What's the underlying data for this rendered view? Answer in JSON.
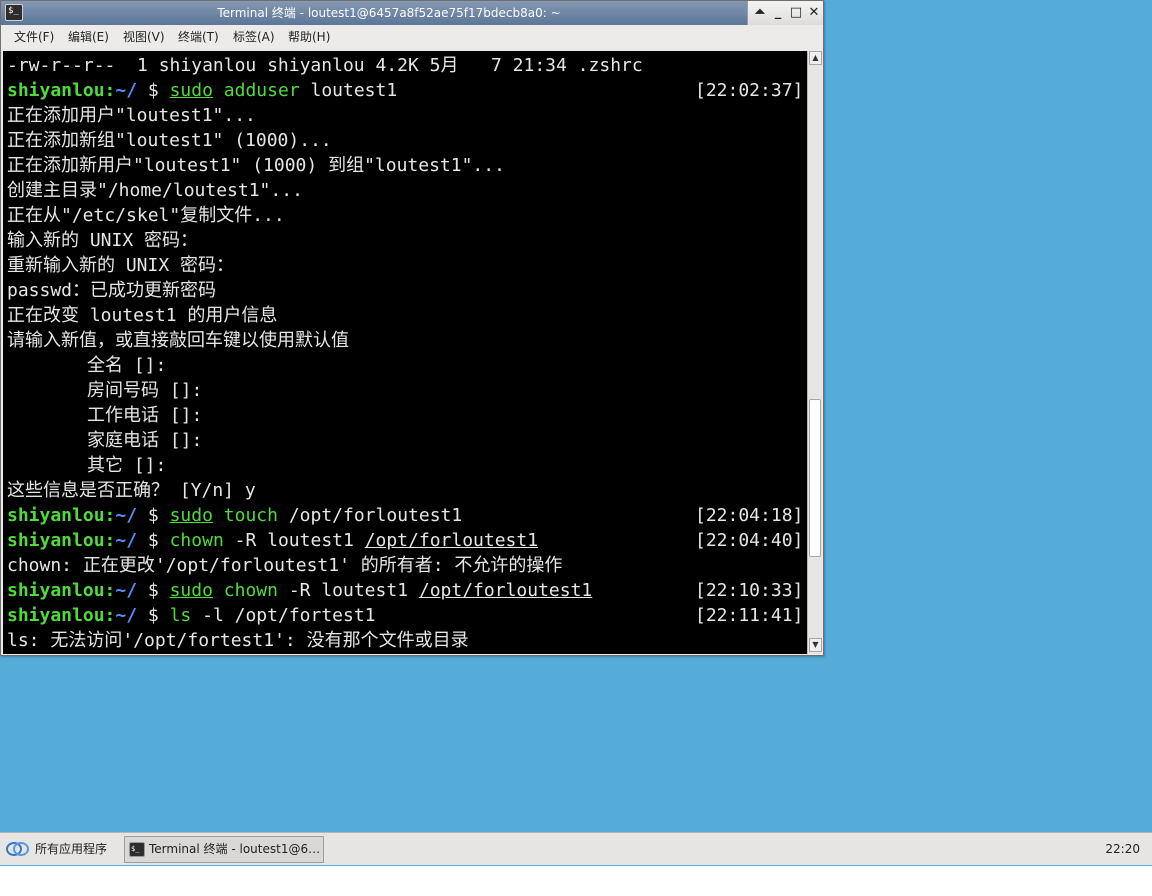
{
  "colors": {
    "desktop": "#55acd9",
    "terminal_bg": "#000000",
    "terminal_fg": "#e6e6e6",
    "prompt_user": "#4fdc3a",
    "prompt_path": "#4f8ff7"
  },
  "window": {
    "title": "Terminal 终端 - loutest1@6457a8f52ae75f17bdecb8a0: ~",
    "icon": "terminal-icon",
    "controls": {
      "shade": "⏶",
      "minimize": "_",
      "maximize": "□",
      "close": "✕"
    }
  },
  "menu": [
    "文件(F)",
    "编辑(E)",
    "视图(V)",
    "终端(T)",
    "标签(A)",
    "帮助(H)"
  ],
  "terminal": {
    "lines": [
      {
        "type": "out",
        "text": "-rw-r--r--  1 shiyanlou shiyanlou 4.2K 5月   7 21:34 .zshrc"
      },
      {
        "type": "prompt",
        "user": "shiyanlou",
        "colon": ":",
        "path": "~/",
        "dollar": " $ ",
        "cmd": [
          {
            "t": "sudo",
            "s": "cmd ul"
          },
          {
            "t": " ",
            "s": ""
          },
          {
            "t": "adduser",
            "s": "cmd"
          },
          {
            "t": " loutest1",
            "s": ""
          }
        ],
        "time": "[22:02:37]"
      },
      {
        "type": "out",
        "text": "正在添加用户\"loutest1\"..."
      },
      {
        "type": "out",
        "text": "正在添加新组\"loutest1\" (1000)..."
      },
      {
        "type": "out",
        "text": "正在添加新用户\"loutest1\" (1000) 到组\"loutest1\"..."
      },
      {
        "type": "out",
        "text": "创建主目录\"/home/loutest1\"..."
      },
      {
        "type": "out",
        "text": "正在从\"/etc/skel\"复制文件..."
      },
      {
        "type": "out",
        "text": "输入新的 UNIX 密码："
      },
      {
        "type": "out",
        "text": "重新输入新的 UNIX 密码："
      },
      {
        "type": "out",
        "text": "passwd：已成功更新密码"
      },
      {
        "type": "out",
        "text": "正在改变 loutest1 的用户信息"
      },
      {
        "type": "out",
        "text": "请输入新值，或直接敲回车键以使用默认值"
      },
      {
        "type": "indent",
        "text": "全名 []:"
      },
      {
        "type": "indent",
        "text": "房间号码 []:"
      },
      {
        "type": "indent",
        "text": "工作电话 []:"
      },
      {
        "type": "indent",
        "text": "家庭电话 []:"
      },
      {
        "type": "indent",
        "text": "其它 []:"
      },
      {
        "type": "out",
        "text": "这些信息是否正确？ [Y/n] y"
      },
      {
        "type": "prompt",
        "user": "shiyanlou",
        "colon": ":",
        "path": "~/",
        "dollar": " $ ",
        "cmd": [
          {
            "t": "sudo",
            "s": "cmd ul"
          },
          {
            "t": " ",
            "s": ""
          },
          {
            "t": "touch",
            "s": "cmd"
          },
          {
            "t": " /opt/forloutest1",
            "s": ""
          }
        ],
        "time": "[22:04:18]"
      },
      {
        "type": "prompt",
        "user": "shiyanlou",
        "colon": ":",
        "path": "~/",
        "dollar": " $ ",
        "cmd": [
          {
            "t": "chown",
            "s": "cmd"
          },
          {
            "t": " -R loutest1 ",
            "s": ""
          },
          {
            "t": "/opt/forloutest1",
            "s": "ul"
          }
        ],
        "time": "[22:04:40]"
      },
      {
        "type": "out",
        "text": "chown: 正在更改'/opt/forloutest1' 的所有者: 不允许的操作"
      },
      {
        "type": "prompt",
        "user": "shiyanlou",
        "colon": ":",
        "path": "~/",
        "dollar": " $ ",
        "cmd": [
          {
            "t": "sudo",
            "s": "cmd ul"
          },
          {
            "t": " ",
            "s": ""
          },
          {
            "t": "chown",
            "s": "cmd"
          },
          {
            "t": " -R loutest1 ",
            "s": ""
          },
          {
            "t": "/opt/forloutest1",
            "s": "ul"
          }
        ],
        "time": "[22:10:33]"
      },
      {
        "type": "prompt",
        "user": "shiyanlou",
        "colon": ":",
        "path": "~/",
        "dollar": " $ ",
        "cmd": [
          {
            "t": "ls",
            "s": "cmd"
          },
          {
            "t": " -l /opt/fortest1",
            "s": ""
          }
        ],
        "time": "[22:11:41]"
      },
      {
        "type": "out",
        "text": "ls: 无法访问'/opt/fortest1': 没有那个文件或目录"
      }
    ]
  },
  "scrollbar": {
    "up": "▲",
    "down": "▼"
  },
  "taskbar": {
    "start_label": "所有应用程序",
    "task_label": "Terminal 终端 - loutest1@6…",
    "clock": "22:20"
  }
}
